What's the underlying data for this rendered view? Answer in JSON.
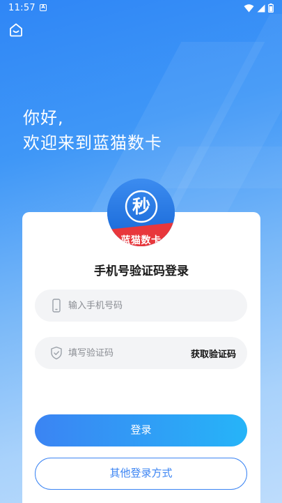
{
  "status_bar": {
    "time": "11:57",
    "notification_icon": "A"
  },
  "header": {
    "home_icon": "home-icon"
  },
  "greeting": {
    "line1": "你好,",
    "line2": "欢迎来到蓝猫数卡"
  },
  "logo": {
    "caption": "蓝猫数卡",
    "emblem": "秒"
  },
  "login": {
    "title": "手机号验证码登录",
    "phone_placeholder": "输入手机号码",
    "code_placeholder": "填写验证码",
    "get_code_label": "获取验证码",
    "submit_label": "登录",
    "other_methods_label": "其他登录方式"
  },
  "colors": {
    "primary": "#3b84f3",
    "accent": "#26b4f8",
    "logo_red": "#e8373c"
  }
}
